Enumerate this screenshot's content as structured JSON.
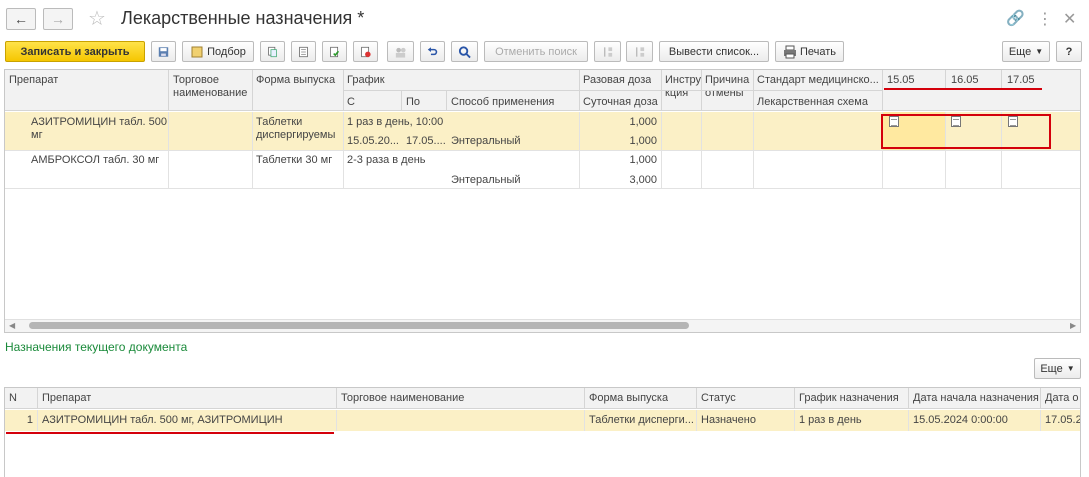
{
  "window": {
    "title": "Лекарственные назначения *"
  },
  "toolbar": {
    "save_close": "Записать и закрыть",
    "podbor": "Подбор",
    "cancel_search": "Отменить поиск",
    "output_list": "Вывести список...",
    "print": "Печать",
    "more": "Еще"
  },
  "main_table": {
    "headers": {
      "preparat": "Препарат",
      "trade_name": "Торговое наименование",
      "form": "Форма выпуска",
      "schedule": "График",
      "from": "С",
      "to": "По",
      "method": "Способ применения",
      "single_dose": "Разовая доза",
      "daily_dose": "Суточная доза",
      "instr": "Инструкция",
      "cancel_reason": "Причина отмены",
      "standard": "Стандарт медицинско...",
      "drug_scheme": "Лекарственная схема",
      "d1": "15.05",
      "d2": "16.05",
      "d3": "17.05"
    },
    "rows": [
      {
        "preparat": "АЗИТРОМИЦИН табл. 500 мг",
        "form": "Таблетки диспергируемы",
        "schedule": "1 раз в день, 10:00",
        "from": "15.05.20...",
        "to": "17.05....",
        "method": "Энтеральный",
        "single_dose": "1,000",
        "daily_dose": "1,000"
      },
      {
        "preparat": "АМБРОКСОЛ табл. 30 мг",
        "form": "Таблетки 30 мг",
        "schedule": "2-3 раза в день",
        "method": "Энтеральный",
        "single_dose": "1,000",
        "daily_dose": "3,000"
      }
    ]
  },
  "section": {
    "label": "Назначения текущего документа",
    "more": "Еще"
  },
  "bottom_table": {
    "headers": {
      "n": "N",
      "preparat": "Препарат",
      "trade_name": "Торговое наименование",
      "form": "Форма выпуска",
      "status": "Статус",
      "schedule": "График назначения",
      "start_date": "Дата начала назначения",
      "date2": "Дата о"
    },
    "rows": [
      {
        "n": "1",
        "preparat": "АЗИТРОМИЦИН табл. 500 мг, АЗИТРОМИЦИН",
        "form": "Таблетки дисперги...",
        "status": "Назначено",
        "schedule": "1 раз в день",
        "start_date": "15.05.2024 0:00:00",
        "date2": "17.05.2"
      }
    ]
  },
  "colors": {
    "accent_yellow": "#f5c600",
    "row_selected": "#fbf0c6",
    "highlight_red": "#d4000b",
    "section_green": "#1a8a3a"
  }
}
